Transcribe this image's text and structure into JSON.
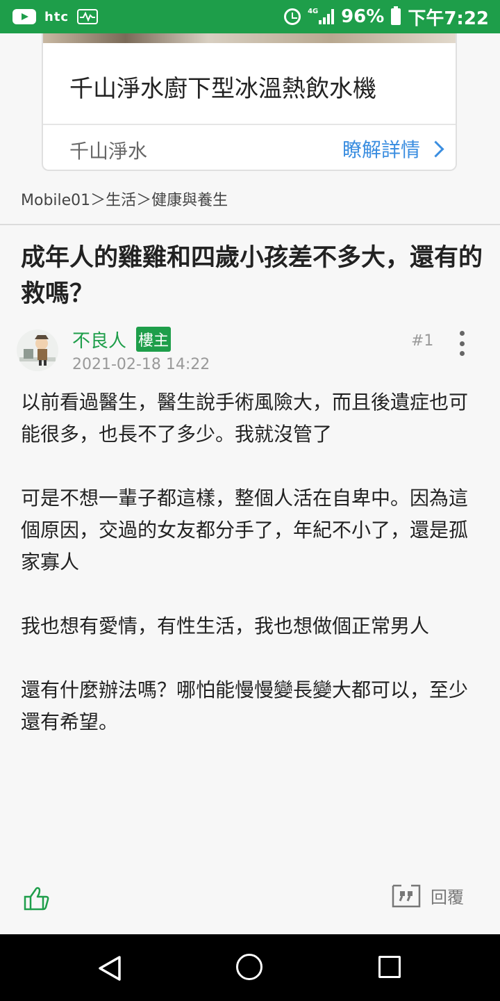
{
  "status_bar": {
    "carrier": "htc",
    "network": "4G",
    "battery": "96%",
    "time": "下午7:22"
  },
  "ad": {
    "title": "千山淨水廚下型冰溫熱飲水機",
    "brand": "千山淨水",
    "cta": "瞭解詳情"
  },
  "breadcrumb": "Mobile01＞生活＞健康與養生",
  "thread": {
    "title": "成年人的雞雞和四歲小孩差不多大，還有的救嗎？"
  },
  "post": {
    "author": "不良人",
    "badge": "樓主",
    "date": "2021-02-18 14:22",
    "floor": "#1",
    "paragraphs": [
      "以前看過醫生，醫生說手術風險大，而且後遺症也可能很多，也長不了多少。我就沒管了",
      "可是不想一輩子都這樣，整個人活在自卑中。因為這個原因，交過的女友都分手了，年紀不小了，還是孤家寡人",
      "我也想有愛情，有性生活，我也想做個正常男人",
      "還有什麼辦法嗎？哪怕能慢慢變長變大都可以，至少還有希望。"
    ],
    "reply_label": "回覆"
  },
  "colors": {
    "brand_green": "#1e9e4a",
    "link_blue": "#3b8ee0"
  }
}
